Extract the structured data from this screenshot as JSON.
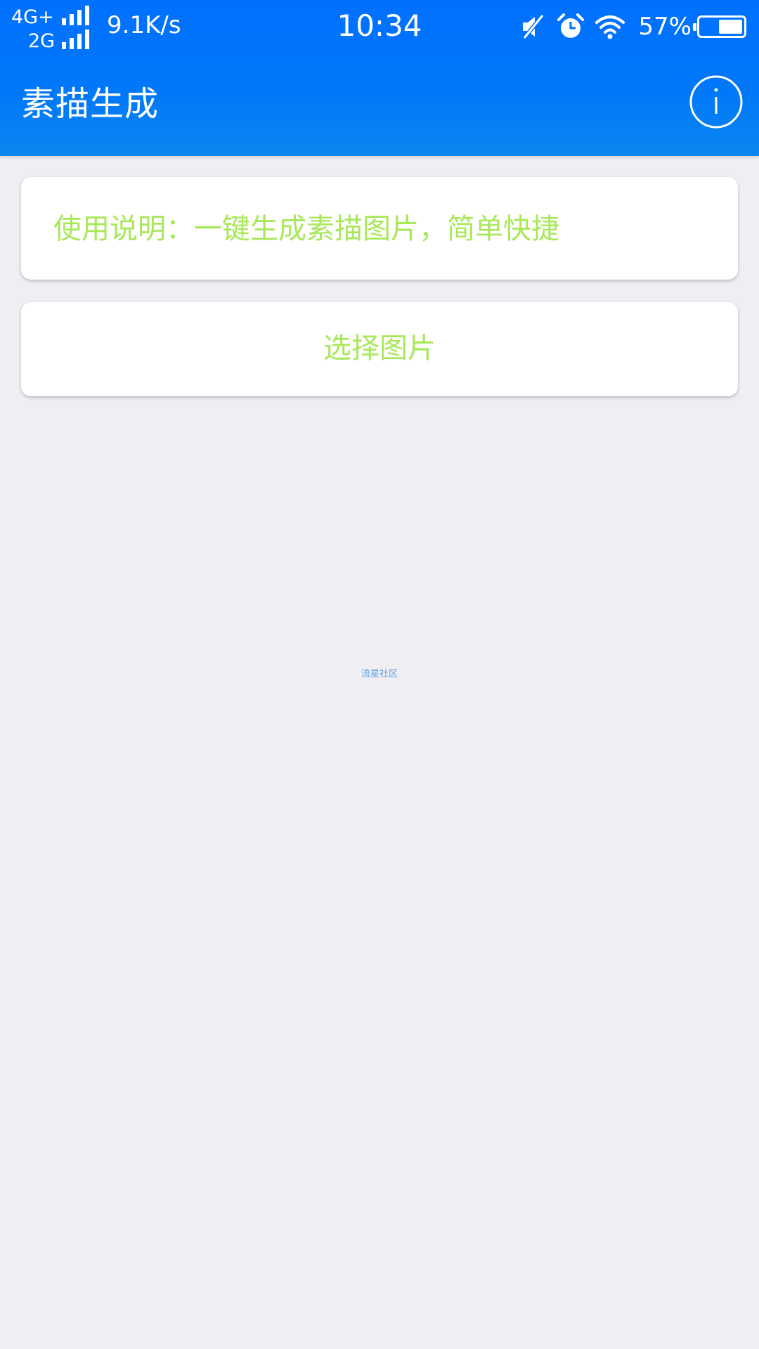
{
  "status_bar": {
    "network_primary": "4G+",
    "network_secondary": "2G",
    "speed": "9.1K/s",
    "time": "10:34",
    "battery_percent": "57%",
    "battery_level": 0.57,
    "icons": [
      "signal-icon",
      "signal-icon",
      "mute-icon",
      "alarm-icon",
      "wifi-icon",
      "battery-icon"
    ]
  },
  "app_bar": {
    "title": "素描生成",
    "info_icon": "info-icon",
    "background_color": "#0070ff"
  },
  "instructions": {
    "text": "使用说明：一键生成素描图片，简单快捷",
    "text_color": "#a8e85a"
  },
  "select_button": {
    "label": "选择图片"
  },
  "watermark": {
    "text": "流星社区"
  }
}
